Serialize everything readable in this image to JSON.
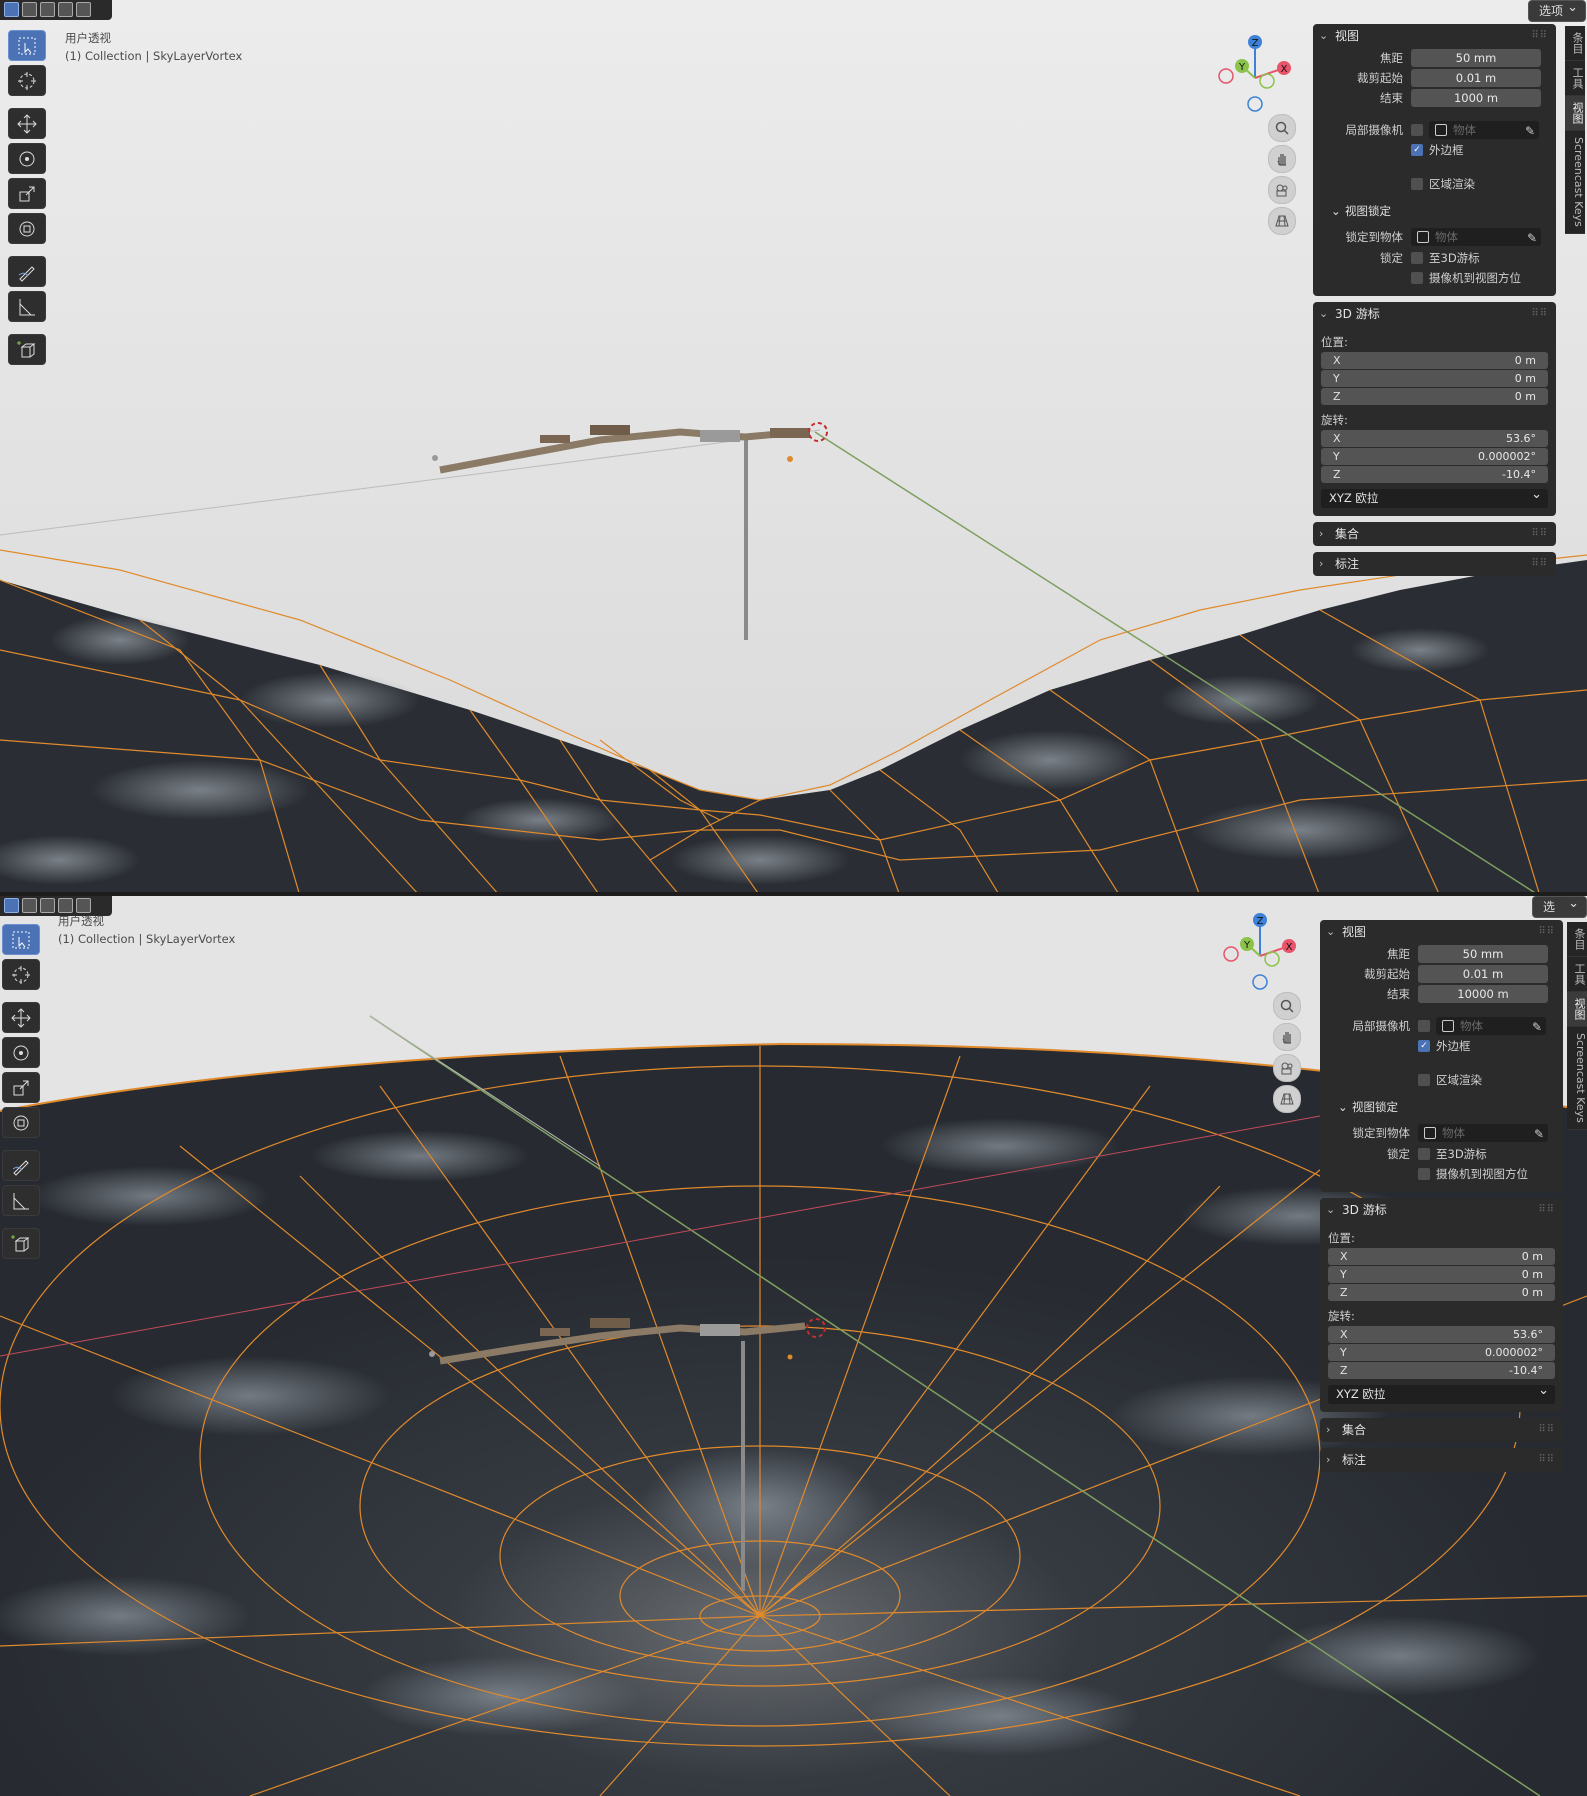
{
  "top": {
    "info_line1": "用户透视",
    "info_line2": "(1) Collection | SkyLayerVortex",
    "options_label": "选项",
    "view": {
      "section_title": "视图",
      "focal_label": "焦距",
      "focal_value": "50 mm",
      "clip_start_label": "裁剪起始",
      "clip_start_value": "0.01 m",
      "clip_end_label": "结束",
      "clip_end_value": "1000 m",
      "local_camera_label": "局部摄像机",
      "object_placeholder": "物体",
      "border_label": "外边框",
      "region_render_label": "区域渲染",
      "lock_section_title": "视图锁定",
      "lock_to_object_label": "锁定到物体",
      "lock_label": "锁定",
      "to_cursor_label": "至3D游标",
      "camera_to_view_label": "摄像机到视图方位"
    },
    "cursor": {
      "section_title": "3D 游标",
      "location_label": "位置:",
      "loc_x": "0 m",
      "loc_y": "0 m",
      "loc_z": "0 m",
      "rotation_label": "旋转:",
      "rot_x": "53.6°",
      "rot_y": "0.000002°",
      "rot_z": "-10.4°",
      "mode": "XYZ 欧拉"
    },
    "collection_label": "集合",
    "annotation_label": "标注"
  },
  "bottom": {
    "info_line1": "用户透视",
    "info_line2": "(1) Collection | SkyLayerVortex",
    "options_label": "选项",
    "view": {
      "section_title": "视图",
      "focal_label": "焦距",
      "focal_value": "50 mm",
      "clip_start_label": "裁剪起始",
      "clip_start_value": "0.01 m",
      "clip_end_label": "结束",
      "clip_end_value": "10000 m",
      "local_camera_label": "局部摄像机",
      "object_placeholder": "物体",
      "border_label": "外边框",
      "region_render_label": "区域渲染",
      "lock_section_title": "视图锁定",
      "lock_to_object_label": "锁定到物体",
      "lock_label": "锁定",
      "to_cursor_label": "至3D游标",
      "camera_to_view_label": "摄像机到视图方位"
    },
    "cursor": {
      "section_title": "3D 游标",
      "location_label": "位置:",
      "loc_x": "0 m",
      "loc_y": "0 m",
      "loc_z": "0 m",
      "rotation_label": "旋转:",
      "rot_x": "53.6°",
      "rot_y": "0.000002°",
      "rot_z": "-10.4°",
      "mode": "XYZ 欧拉"
    },
    "collection_label": "集合",
    "annotation_label": "标注"
  },
  "axes": {
    "x": "X",
    "y": "Y",
    "z": "Z"
  },
  "axis_labels": {
    "x": "X",
    "y": "Y",
    "z": "Z"
  },
  "sidebar_tabs": [
    "条目",
    "工具",
    "视图",
    "Screencast Keys"
  ],
  "colors": {
    "wire": "#e08a2c",
    "sky": "#e3e3e3",
    "ground": "#2b2f35",
    "accent": "#4a72b5",
    "x_axis": "#e8546a",
    "y_axis": "#8bc34a",
    "z_axis": "#3d82d8"
  }
}
